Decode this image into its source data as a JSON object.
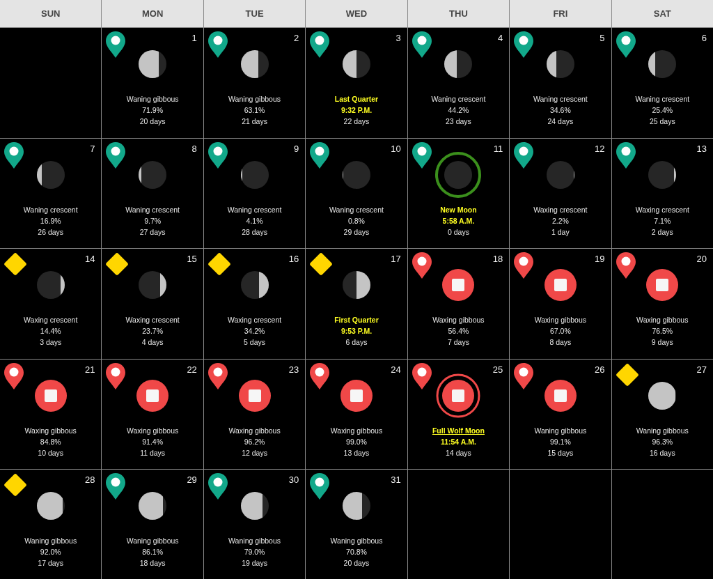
{
  "weekdays": [
    "SUN",
    "MON",
    "TUE",
    "WED",
    "THU",
    "FRI",
    "SAT"
  ],
  "weeks": [
    [
      {
        "kind": "blank"
      },
      {
        "kind": "moon",
        "day": "1",
        "marker": {
          "kind": "pin",
          "color": "#12a88a"
        },
        "level": 0.72,
        "waxing": false,
        "title": {
          "kind": "phase",
          "text": "Waning gibbous"
        },
        "detail": "71.9%",
        "age": "20 days"
      },
      {
        "kind": "moon",
        "day": "2",
        "marker": {
          "kind": "pin",
          "color": "#12a88a"
        },
        "level": 0.63,
        "waxing": false,
        "title": {
          "kind": "phase",
          "text": "Waning gibbous"
        },
        "detail": "63.1%",
        "age": "21 days"
      },
      {
        "kind": "moon",
        "day": "3",
        "marker": {
          "kind": "pin",
          "color": "#12a88a"
        },
        "level": 0.5,
        "waxing": false,
        "title": {
          "kind": "event",
          "text": "Last Quarter"
        },
        "detail": "9:32 P.M.",
        "age": "22 days"
      },
      {
        "kind": "moon",
        "day": "4",
        "marker": {
          "kind": "pin",
          "color": "#12a88a"
        },
        "level": 0.44,
        "waxing": false,
        "title": {
          "kind": "phase",
          "text": "Waning crescent"
        },
        "detail": "44.2%",
        "age": "23 days"
      },
      {
        "kind": "moon",
        "day": "5",
        "marker": {
          "kind": "pin",
          "color": "#12a88a"
        },
        "level": 0.35,
        "waxing": false,
        "title": {
          "kind": "phase",
          "text": "Waning crescent"
        },
        "detail": "34.6%",
        "age": "24 days"
      },
      {
        "kind": "moon",
        "day": "6",
        "marker": {
          "kind": "pin",
          "color": "#12a88a"
        },
        "level": 0.25,
        "waxing": false,
        "title": {
          "kind": "phase",
          "text": "Waning crescent"
        },
        "detail": "25.4%",
        "age": "25 days"
      }
    ],
    [
      {
        "kind": "moon",
        "day": "7",
        "marker": {
          "kind": "pin",
          "color": "#12a88a"
        },
        "level": 0.17,
        "waxing": false,
        "title": {
          "kind": "phase",
          "text": "Waning crescent"
        },
        "detail": "16.9%",
        "age": "26 days"
      },
      {
        "kind": "moon",
        "day": "8",
        "marker": {
          "kind": "pin",
          "color": "#12a88a"
        },
        "level": 0.1,
        "waxing": false,
        "title": {
          "kind": "phase",
          "text": "Waning crescent"
        },
        "detail": "9.7%",
        "age": "27 days"
      },
      {
        "kind": "moon",
        "day": "9",
        "marker": {
          "kind": "pin",
          "color": "#12a88a"
        },
        "level": 0.05,
        "waxing": false,
        "title": {
          "kind": "phase",
          "text": "Waning crescent"
        },
        "detail": "4.1%",
        "age": "28 days"
      },
      {
        "kind": "moon",
        "day": "10",
        "marker": {
          "kind": "pin",
          "color": "#12a88a"
        },
        "level": 0.02,
        "waxing": false,
        "title": {
          "kind": "phase",
          "text": "Waning crescent"
        },
        "detail": "0.8%",
        "age": "29 days"
      },
      {
        "kind": "moon",
        "day": "11",
        "marker": {
          "kind": "pin",
          "color": "#12a88a"
        },
        "level": 0,
        "ring": {
          "color": "#3b8f1c"
        },
        "title": {
          "kind": "event",
          "text": "New Moon"
        },
        "detail": "5:58 A.M.",
        "age": "0 days"
      },
      {
        "kind": "moon",
        "day": "12",
        "marker": {
          "kind": "pin",
          "color": "#12a88a"
        },
        "level": 0.03,
        "waxing": true,
        "title": {
          "kind": "phase",
          "text": "Waxing crescent"
        },
        "detail": "2.2%",
        "age": "1 day"
      },
      {
        "kind": "moon",
        "day": "13",
        "marker": {
          "kind": "pin",
          "color": "#12a88a"
        },
        "level": 0.07,
        "waxing": true,
        "title": {
          "kind": "phase",
          "text": "Waxing crescent"
        },
        "detail": "7.1%",
        "age": "2 days"
      }
    ],
    [
      {
        "kind": "moon",
        "day": "14",
        "marker": {
          "kind": "diamond",
          "color": "#ffd600"
        },
        "level": 0.14,
        "waxing": true,
        "title": {
          "kind": "phase",
          "text": "Waxing crescent"
        },
        "detail": "14.4%",
        "age": "3 days"
      },
      {
        "kind": "moon",
        "day": "15",
        "marker": {
          "kind": "diamond",
          "color": "#ffd600"
        },
        "level": 0.24,
        "waxing": true,
        "title": {
          "kind": "phase",
          "text": "Waxing crescent"
        },
        "detail": "23.7%",
        "age": "4 days"
      },
      {
        "kind": "moon",
        "day": "16",
        "marker": {
          "kind": "diamond",
          "color": "#ffd600"
        },
        "level": 0.34,
        "waxing": true,
        "title": {
          "kind": "phase",
          "text": "Waxing crescent"
        },
        "detail": "34.2%",
        "age": "5 days"
      },
      {
        "kind": "moon",
        "day": "17",
        "marker": {
          "kind": "diamond",
          "color": "#ffd600"
        },
        "level": 0.5,
        "waxing": true,
        "title": {
          "kind": "event",
          "text": "First Quarter"
        },
        "detail": "9:53 P.M.",
        "age": "6 days"
      },
      {
        "kind": "stop",
        "day": "18",
        "marker": {
          "kind": "pin",
          "color": "#f04848"
        },
        "title": {
          "kind": "phase",
          "text": "Waxing gibbous"
        },
        "detail": "56.4%",
        "age": "7 days"
      },
      {
        "kind": "stop",
        "day": "19",
        "marker": {
          "kind": "pin",
          "color": "#f04848"
        },
        "title": {
          "kind": "phase",
          "text": "Waxing gibbous"
        },
        "detail": "67.0%",
        "age": "8 days"
      },
      {
        "kind": "stop",
        "day": "20",
        "marker": {
          "kind": "pin",
          "color": "#f04848"
        },
        "title": {
          "kind": "phase",
          "text": "Waxing gibbous"
        },
        "detail": "76.5%",
        "age": "9 days"
      }
    ],
    [
      {
        "kind": "stop",
        "day": "21",
        "marker": {
          "kind": "pin",
          "color": "#f04848"
        },
        "title": {
          "kind": "phase",
          "text": "Waxing gibbous"
        },
        "detail": "84.8%",
        "age": "10 days"
      },
      {
        "kind": "stop",
        "day": "22",
        "marker": {
          "kind": "pin",
          "color": "#f04848"
        },
        "title": {
          "kind": "phase",
          "text": "Waxing gibbous"
        },
        "detail": "91.4%",
        "age": "11 days"
      },
      {
        "kind": "stop",
        "day": "23",
        "marker": {
          "kind": "pin",
          "color": "#f04848"
        },
        "title": {
          "kind": "phase",
          "text": "Waxing gibbous"
        },
        "detail": "96.2%",
        "age": "12 days"
      },
      {
        "kind": "stop",
        "day": "24",
        "marker": {
          "kind": "pin",
          "color": "#f04848"
        },
        "title": {
          "kind": "phase",
          "text": "Waxing gibbous"
        },
        "detail": "99.0%",
        "age": "13 days"
      },
      {
        "kind": "stop",
        "day": "25",
        "marker": {
          "kind": "pin",
          "color": "#f04848"
        },
        "ring": {
          "color": "#f04848"
        },
        "title": {
          "kind": "link",
          "text": "Full Wolf Moon"
        },
        "detail": "11:54 A.M.",
        "age": "14 days"
      },
      {
        "kind": "stop",
        "day": "26",
        "marker": {
          "kind": "pin",
          "color": "#f04848"
        },
        "title": {
          "kind": "phase",
          "text": "Waning gibbous"
        },
        "detail": "99.1%",
        "age": "15 days"
      },
      {
        "kind": "moon",
        "day": "27",
        "marker": {
          "kind": "diamond",
          "color": "#ffd600"
        },
        "level": 0.96,
        "waxing": false,
        "title": {
          "kind": "phase",
          "text": "Waning gibbous"
        },
        "detail": "96.3%",
        "age": "16 days"
      }
    ],
    [
      {
        "kind": "moon",
        "day": "28",
        "marker": {
          "kind": "diamond",
          "color": "#ffd600"
        },
        "level": 0.92,
        "waxing": false,
        "title": {
          "kind": "phase",
          "text": "Waning gibbous"
        },
        "detail": "92.0%",
        "age": "17 days"
      },
      {
        "kind": "moon",
        "day": "29",
        "marker": {
          "kind": "pin",
          "color": "#12a88a"
        },
        "level": 0.86,
        "waxing": false,
        "title": {
          "kind": "phase",
          "text": "Waning gibbous"
        },
        "detail": "86.1%",
        "age": "18 days"
      },
      {
        "kind": "moon",
        "day": "30",
        "marker": {
          "kind": "pin",
          "color": "#12a88a"
        },
        "level": 0.79,
        "waxing": false,
        "title": {
          "kind": "phase",
          "text": "Waning gibbous"
        },
        "detail": "79.0%",
        "age": "19 days"
      },
      {
        "kind": "moon",
        "day": "31",
        "marker": {
          "kind": "pin",
          "color": "#12a88a"
        },
        "level": 0.71,
        "waxing": false,
        "title": {
          "kind": "phase",
          "text": "Waning gibbous"
        },
        "detail": "70.8%",
        "age": "20 days"
      },
      {
        "kind": "blank"
      },
      {
        "kind": "blank"
      },
      {
        "kind": "blank"
      }
    ]
  ]
}
